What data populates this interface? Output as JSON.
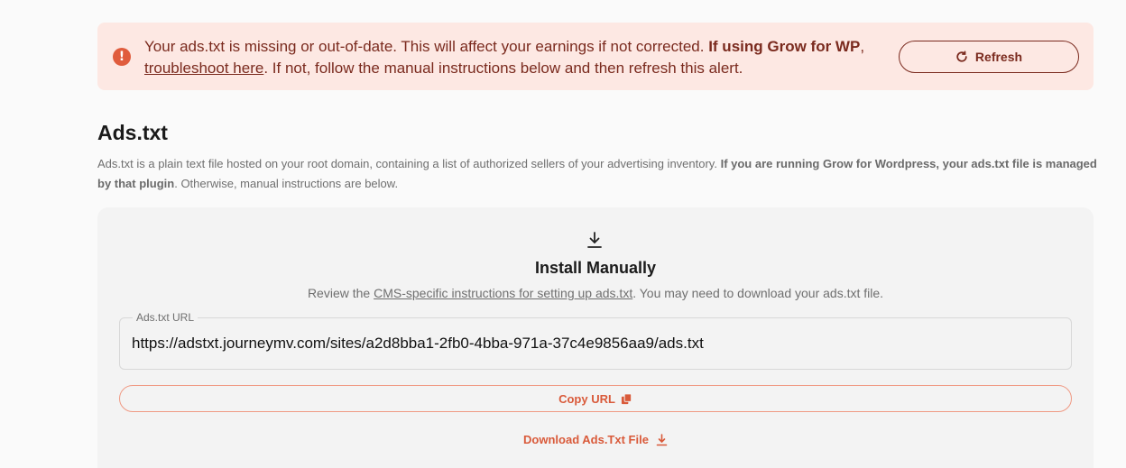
{
  "alert": {
    "icon": "exclamation-circle-icon",
    "text_prefix": "Your ads.txt is missing or out-of-date. This will affect your earnings if not corrected. ",
    "bold_text": "If using Grow for WP",
    "comma": ", ",
    "link_text": "troubleshoot here",
    "text_suffix": ". If not, follow the manual instructions below and then refresh this alert.",
    "refresh_label": "Refresh",
    "refresh_icon": "refresh-icon",
    "bg_color": "#fde8e3",
    "text_color": "#7a2a1e"
  },
  "section": {
    "title": "Ads.txt",
    "desc_prefix": "Ads.txt is a plain text file hosted on your root domain, containing a list of authorized sellers of your advertising inventory. ",
    "desc_bold": "If you are running Grow for Wordpress, your ads.txt file is managed by that plugin",
    "desc_suffix": ". Otherwise, manual instructions are below."
  },
  "card": {
    "icon": "download-icon",
    "title": "Install Manually",
    "sub_prefix": "Review the ",
    "sub_link": "CMS-specific instructions for setting up ads.txt",
    "sub_suffix": ". You may need to download your ads.txt file.",
    "url_label": "Ads.txt URL",
    "url_value": "https://adstxt.journeymv.com/sites/a2d8bba1-2fb0-4bba-971a-37c4e9856aa9/ads.txt",
    "copy_label": "Copy URL",
    "copy_icon": "copy-icon",
    "download_label": "Download Ads.Txt File",
    "download_icon": "download-icon",
    "accent_color": "#d95a3a"
  }
}
